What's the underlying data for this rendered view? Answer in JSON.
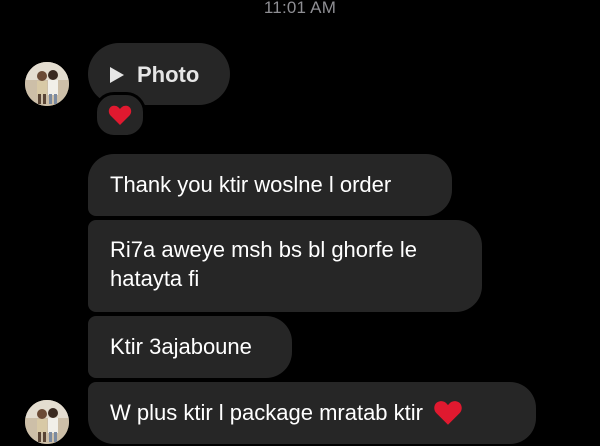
{
  "timestamp": "11:01 AM",
  "colors": {
    "background": "#000000",
    "bubble": "#262626",
    "text": "#ffffff",
    "timestamp": "#8e8e93",
    "heart": "#e0192f"
  },
  "photo_message": {
    "icon": "play-icon",
    "label": "Photo",
    "reaction": "heart-icon"
  },
  "messages": [
    {
      "text": "Thank you ktir woslne l order"
    },
    {
      "text": "Ri7a aweye msh bs bl ghorfe le hatayta fi"
    },
    {
      "text": "Ktir 3ajaboune"
    },
    {
      "text": "W plus ktir l package mratab ktir",
      "emoji": "heart-icon"
    }
  ]
}
